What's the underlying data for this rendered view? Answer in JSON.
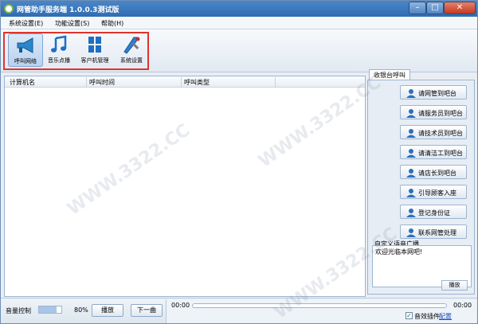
{
  "window": {
    "title": "网管助手服务端 1.0.0.3测试版",
    "controls": {
      "minimize": "–",
      "maximize": "□",
      "close": "✕"
    }
  },
  "menu": [
    {
      "label": "系统设置(E)"
    },
    {
      "label": "功能设置(S)"
    },
    {
      "label": "帮助(H)"
    }
  ],
  "toolbar": [
    {
      "label": "呼叫网络",
      "icon": "megaphone-icon",
      "active": true
    },
    {
      "label": "音乐点播",
      "icon": "music-note-icon",
      "active": false
    },
    {
      "label": "客户机管理",
      "icon": "windows-tiles-icon",
      "active": false
    },
    {
      "label": "系统设置",
      "icon": "tools-icon",
      "active": false
    }
  ],
  "table": {
    "columns": [
      "计算机名",
      "呼叫时间",
      "呼叫类型"
    ],
    "rows": []
  },
  "side": {
    "tab_label": "收银台呼叫",
    "buttons": [
      "请网管到吧台",
      "请服务员到吧台",
      "请技术员到吧台",
      "请清洁工到吧台",
      "请店长到吧台",
      "引导顾客入座",
      "登记身份证",
      "联系网管处理"
    ],
    "broadcast_label": "自定义语音广播",
    "broadcast_text": "欢迎光临本网吧!",
    "play_label": "播放"
  },
  "bottom": {
    "volume_label": "音量控制",
    "volume_value": 80,
    "volume_pct": "80%",
    "play_label": "播放",
    "next_label": "下一曲",
    "time_start": "00:00",
    "time_end": "00:00",
    "sound_plugin_label": "音效插件",
    "config_link": "配置"
  },
  "watermark": "WWW.3322.CC",
  "colors": {
    "accent": "#2f6cb2",
    "highlight_box": "#e0332d"
  }
}
